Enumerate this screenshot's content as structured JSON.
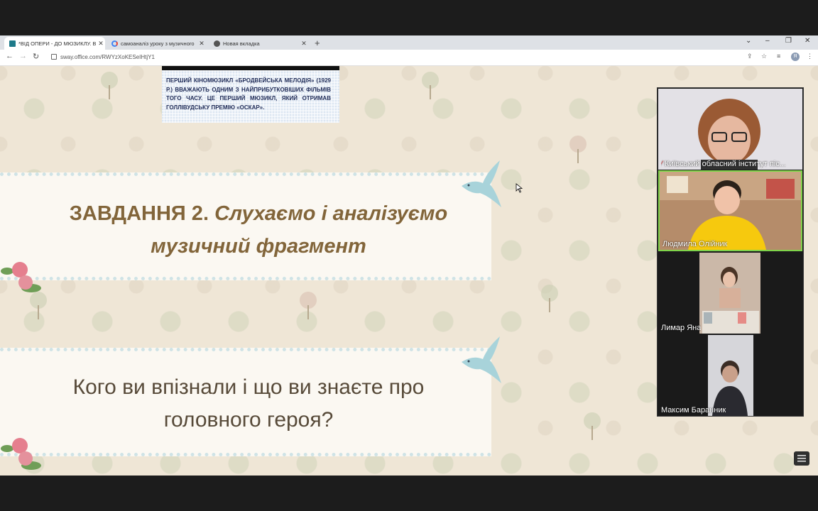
{
  "browser": {
    "tabs": [
      {
        "title": "*ВІД ОПЕРИ - ДО МЮЗИКЛУ. В",
        "active": true,
        "icon": "sway-icon"
      },
      {
        "title": "самоаналіз уроку з музичного",
        "active": false,
        "icon": "google-icon"
      },
      {
        "title": "Новая вкладка",
        "active": false,
        "icon": "chrome-icon"
      }
    ],
    "url": "sway.office.com/RWYzXoKESeIHtjY1",
    "profile_initial": "Я"
  },
  "slide": {
    "image_caption": "ПЕРШИЙ КІНОМЮЗИКЛ «БРОДВЕЙСЬКА МЕЛОДІЯ» (1929 Р.) ВВАЖАЮТЬ ОДНИМ З НАЙПРИБУТКОВІШИХ ФІЛЬМІВ ТОГО ЧАСУ. ЦЕ ПЕРШИЙ МЮЗИКЛ, ЯКИЙ ОТРИМАВ ГОЛЛІВУДСЬКУ ПРЕМІЮ «ОСКАР».",
    "task_number": "ЗАВДАННЯ 2.",
    "task_text": "Слухаємо і аналізуємо музичний фрагмент",
    "question": "Кого ви впізнали і що ви знаєте про головного героя?"
  },
  "video": {
    "participants": [
      {
        "name": "Київський обласний інститут піс..."
      },
      {
        "name": "Людмила Олійник"
      },
      {
        "name": "Лимар Яна"
      },
      {
        "name": "Максим Баранник"
      }
    ]
  },
  "colors": {
    "accent_brown": "#82653a",
    "active_speaker": "#7fd34a",
    "caption_navy": "#1f2b57"
  }
}
